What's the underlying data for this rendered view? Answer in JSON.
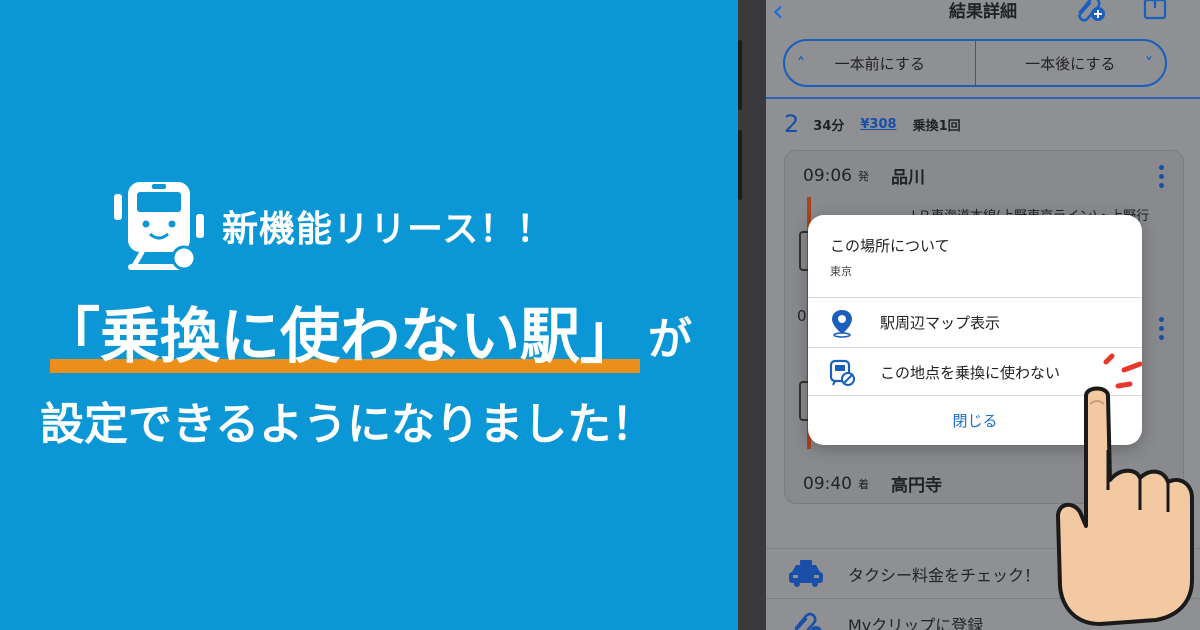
{
  "promo": {
    "badge": "新機能リリース！！",
    "headline_main": "「乗換に使わない駅」",
    "headline_suffix": "が",
    "headline_line2": "設定できるようになりました！"
  },
  "app": {
    "nav": {
      "title": "結果詳細",
      "back_icon": "chevron-left-icon",
      "clip_icon": "clip-add-icon",
      "share_icon": "share-icon"
    },
    "segment": {
      "prev": "一本前にする",
      "next": "一本後にする"
    },
    "summary": {
      "route_no": "2",
      "duration": "34分",
      "fare": "¥308",
      "transfers": "乗換1回"
    },
    "route": {
      "departure": {
        "time": "09:06",
        "kind": "発",
        "station": "品川"
      },
      "line": "ＪＲ東海道本線(上野東京ライン)・上野行",
      "arrival": {
        "time": "09:40",
        "kind": "着",
        "station": "高円寺"
      },
      "fragment": "0"
    },
    "popup": {
      "title": "この場所について",
      "subtitle": "東京",
      "items": [
        {
          "label": "駅周辺マップ表示",
          "icon": "map-pin-icon"
        },
        {
          "label": "この地点を乗換に使わない",
          "icon": "train-block-icon"
        }
      ],
      "close": "閉じる"
    },
    "bottom": [
      {
        "label": "タクシー料金をチェック！",
        "icon": "taxi-icon"
      },
      {
        "label": "Myクリップに登録",
        "icon": "clip-add-icon"
      }
    ]
  },
  "colors": {
    "background": "#0b97d5",
    "accent_underline": "#ec8f1a",
    "primary_blue": "#1a5fbd",
    "line_color": "#a8441b",
    "tap_mark": "#e8382e"
  }
}
